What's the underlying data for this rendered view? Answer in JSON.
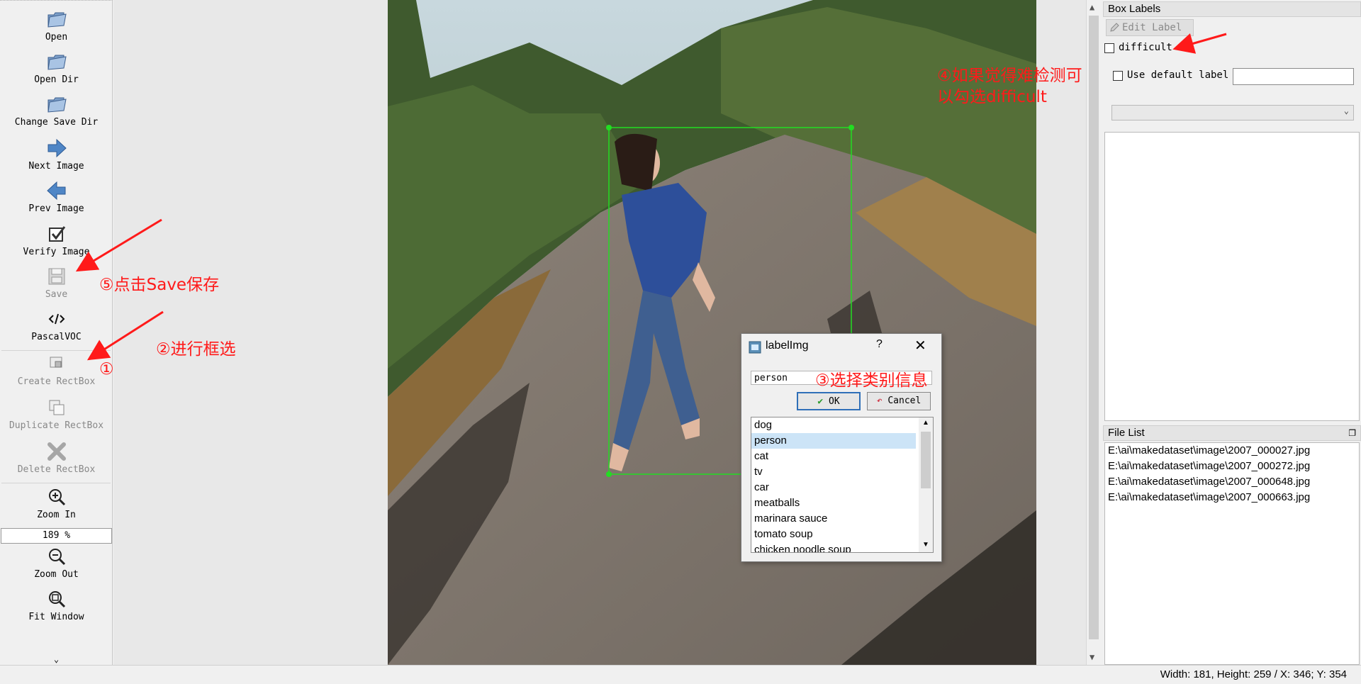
{
  "toolbar": {
    "items": [
      {
        "label": "Open",
        "icon": "open-folder-icon"
      },
      {
        "label": "Open Dir",
        "icon": "open-folder-icon"
      },
      {
        "label": "Change Save Dir",
        "icon": "open-folder-icon"
      },
      {
        "label": "Next Image",
        "icon": "arrow-right-icon"
      },
      {
        "label": "Prev Image",
        "icon": "arrow-left-icon"
      },
      {
        "label": "Verify Image",
        "icon": "checkbox-icon"
      },
      {
        "label": "Save",
        "icon": "save-icon"
      },
      {
        "label": "PascalVOC",
        "icon": "code-icon"
      },
      {
        "label": "Create RectBox",
        "icon": "create-rect-icon"
      },
      {
        "label": "Duplicate RectBox",
        "icon": "duplicate-icon"
      },
      {
        "label": "Delete RectBox",
        "icon": "delete-x-icon"
      },
      {
        "label": "Zoom In",
        "icon": "zoom-in-icon"
      },
      {
        "label": "Zoom Out",
        "icon": "zoom-out-icon"
      },
      {
        "label": "Fit Window",
        "icon": "fit-window-icon"
      }
    ],
    "zoom_value": "189 %",
    "more_glyph": "⌄"
  },
  "dialog": {
    "title": "labelImg",
    "help": "?",
    "close": "✕",
    "input_value": "person",
    "ok_label": "OK",
    "cancel_label": "Cancel",
    "items": [
      "dog",
      "person",
      "cat",
      "tv",
      "car",
      "meatballs",
      "marinara sauce",
      "tomato soup",
      "chicken noodle soup"
    ],
    "selected_index": 1
  },
  "right_panel": {
    "box_labels_title": "Box Labels",
    "edit_label": "Edit Label",
    "difficult_label": "difficult",
    "use_default_label": "Use default label",
    "file_list_title": "File List",
    "files": [
      "E:\\ai\\makedataset\\image\\2007_000027.jpg",
      "E:\\ai\\makedataset\\image\\2007_000272.jpg",
      "E:\\ai\\makedataset\\image\\2007_000648.jpg",
      "E:\\ai\\makedataset\\image\\2007_000663.jpg"
    ]
  },
  "status": {
    "text": "Width: 181, Height: 259 / X: 346; Y: 354"
  },
  "annotations": {
    "step1": "①",
    "step2": "②进行框选",
    "step3": "③选择类别信息",
    "step4_line1": "④如果觉得难检测可",
    "step4_line2": "以勾选difficult",
    "step5": "⑤点击Save保存"
  },
  "colors": {
    "bbox": "#22dd22",
    "annotation": "#ff1a1a",
    "selection": "#cce4f7"
  }
}
